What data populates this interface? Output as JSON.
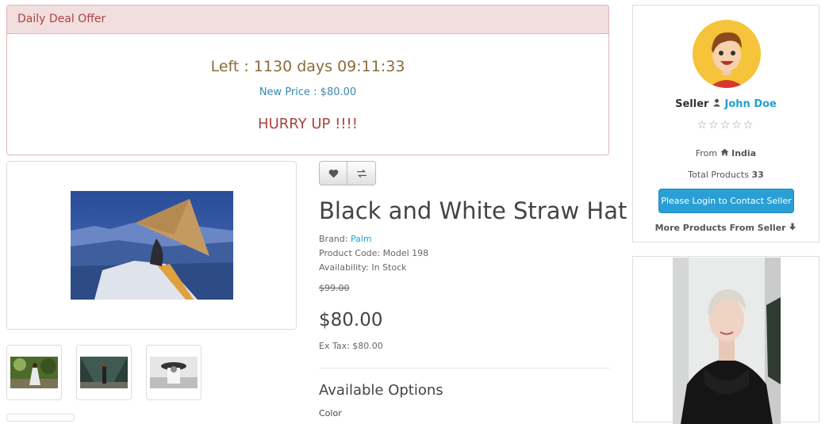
{
  "deal": {
    "heading": "Daily Deal Offer",
    "left": "Left : 1130 days 09:11:33",
    "new_price": "New Price : $80.00",
    "hurry": "HURRY UP !!!!"
  },
  "product": {
    "title": "Black and White Straw Hat",
    "brand_label": "Brand:",
    "brand": "Palm",
    "code": "Product Code: Model 198",
    "availability": "Availability: In Stock",
    "old_price": "$99.00",
    "price": "$80.00",
    "ex_tax": "Ex Tax: $80.00",
    "options_title": "Available Options",
    "color_label": "Color"
  },
  "buttons": {
    "wishlist_icon": "heart-icon",
    "compare_icon": "exchange-icon"
  },
  "seller": {
    "label": "Seller",
    "name": "John Doe",
    "rating": 0,
    "from_label": "From",
    "country": "India",
    "total_label": "Total Products",
    "total": "33",
    "contact_button": "Please Login to Contact Seller",
    "more_products": "More Products From Seller"
  },
  "colors": {
    "deal_bg": "#f2dede",
    "deal_text": "#a94442",
    "link": "#23a1d1",
    "primary_button": "#2a9fd6"
  }
}
